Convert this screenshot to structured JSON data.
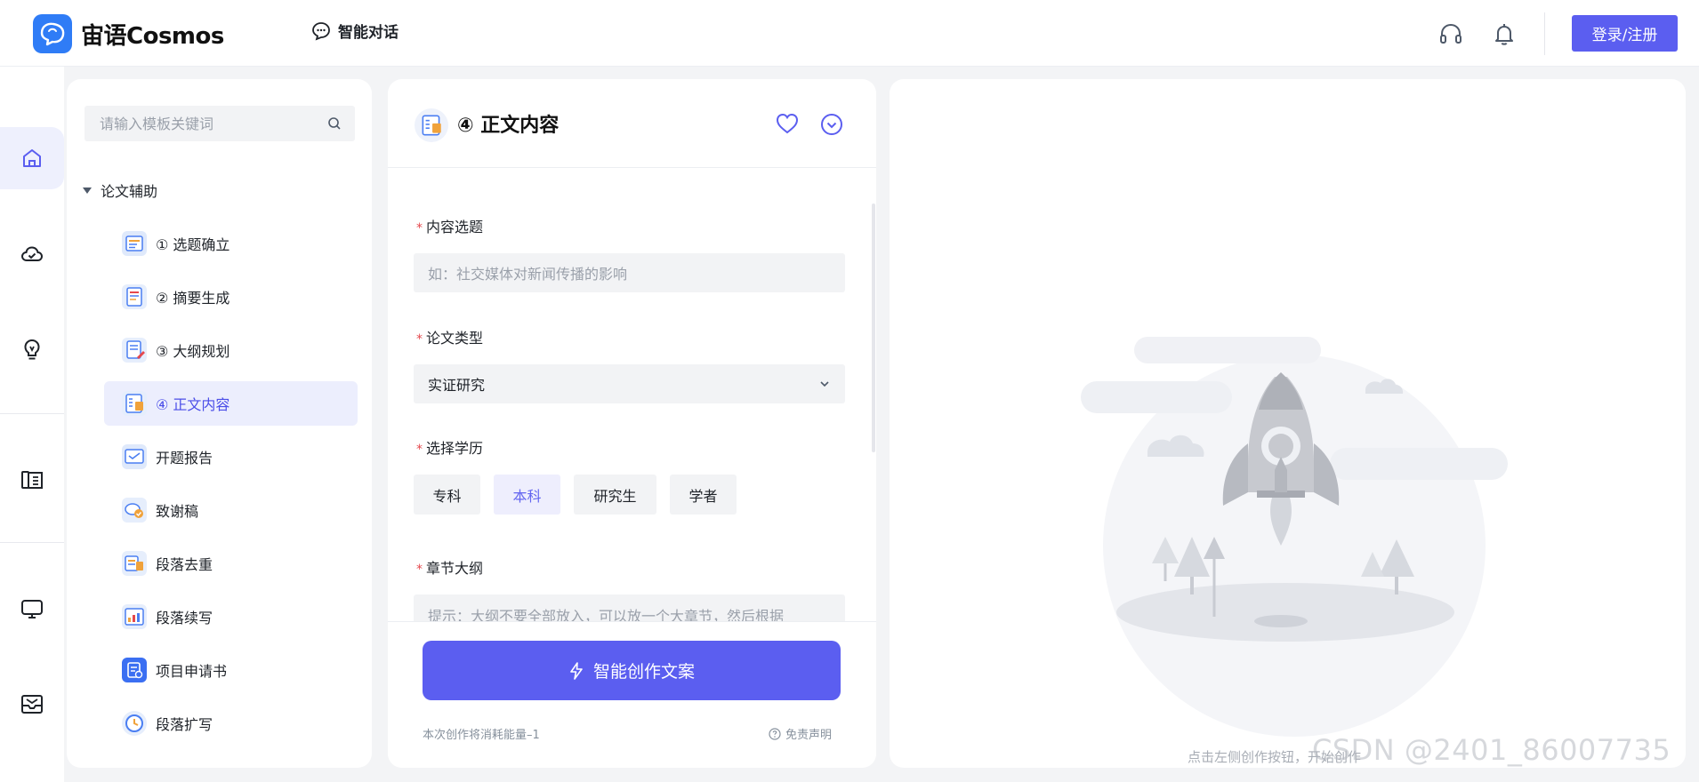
{
  "header": {
    "brand": "宙语Cosmos",
    "chat_link": "智能对话",
    "login_button": "登录/注册"
  },
  "sidebar": {
    "search_placeholder": "请输入模板关键词",
    "group_title": "论文辅助",
    "items": [
      {
        "label": "① 选题确立",
        "active": false
      },
      {
        "label": "② 摘要生成",
        "active": false
      },
      {
        "label": "③ 大纲规划",
        "active": false
      },
      {
        "label": "④ 正文内容",
        "active": true
      },
      {
        "label": "开题报告",
        "active": false
      },
      {
        "label": "致谢稿",
        "active": false
      },
      {
        "label": "段落去重",
        "active": false
      },
      {
        "label": "段落续写",
        "active": false
      },
      {
        "label": "项目申请书",
        "active": false
      },
      {
        "label": "段落扩写",
        "active": false
      }
    ]
  },
  "form": {
    "title": "④ 正文内容",
    "topic_label": "内容选题",
    "topic_placeholder": "如：社交媒体对新闻传播的影响",
    "type_label": "论文类型",
    "type_value": "实证研究",
    "degree_label": "选择学历",
    "degree_options": [
      "专科",
      "本科",
      "研究生",
      "学者"
    ],
    "degree_selected": "本科",
    "outline_label": "章节大纲",
    "outline_placeholder": "提示：大纲不要全部放入，可以放一个大章节，然后根据",
    "create_button": "智能创作文案",
    "cost_note": "本次创作将消耗能量–1",
    "disclaimer": "免责声明"
  },
  "result": {
    "empty_hint": "点击左侧创作按钮，开始创作"
  },
  "watermark": "CSDN @2401_86007735",
  "colors": {
    "accent": "#5b5ef0",
    "active_bg": "#eceefd",
    "required": "#e5484d"
  }
}
